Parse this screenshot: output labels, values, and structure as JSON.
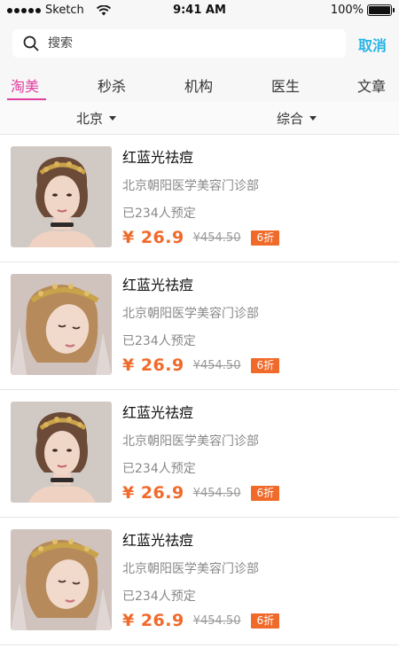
{
  "status_bar": {
    "carrier": "Sketch",
    "time": "9:41 AM",
    "battery": "100%"
  },
  "search": {
    "placeholder": "搜索",
    "cancel_label": "取消"
  },
  "tabs": [
    {
      "label": "淘美",
      "active": true
    },
    {
      "label": "秒杀",
      "active": false
    },
    {
      "label": "机构",
      "active": false
    },
    {
      "label": "医生",
      "active": false
    },
    {
      "label": "文章",
      "active": false
    }
  ],
  "filters": {
    "city": "北京",
    "sort": "综合"
  },
  "colors": {
    "accent_pink": "#e03fa0",
    "cancel_blue": "#27b3e6",
    "price_orange": "#f06a2a"
  },
  "items": [
    {
      "title": "红蓝光祛痘",
      "org": "北京朝阳医学美容门诊部",
      "booked": "已234人预定",
      "price": "¥ 26.9",
      "old_price": "¥454.50",
      "discount": "6折",
      "image": "woman-portrait-gold-headpiece"
    },
    {
      "title": "红蓝光祛痘",
      "org": "北京朝阳医学美容门诊部",
      "booked": "已234人预定",
      "price": "¥ 26.9",
      "old_price": "¥454.50",
      "discount": "6折",
      "image": "woman-portrait-crown-veil"
    },
    {
      "title": "红蓝光祛痘",
      "org": "北京朝阳医学美容门诊部",
      "booked": "已234人预定",
      "price": "¥ 26.9",
      "old_price": "¥454.50",
      "discount": "6折",
      "image": "woman-portrait-gold-headpiece"
    },
    {
      "title": "红蓝光祛痘",
      "org": "北京朝阳医学美容门诊部",
      "booked": "已234人预定",
      "price": "¥ 26.9",
      "old_price": "¥454.50",
      "discount": "6折",
      "image": "woman-portrait-crown-veil"
    }
  ]
}
